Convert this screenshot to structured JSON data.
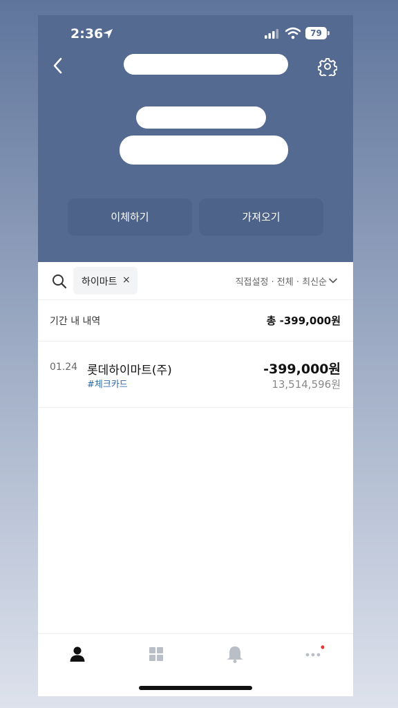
{
  "status_bar": {
    "time": "2:36",
    "battery": "79"
  },
  "account": {
    "actions": {
      "transfer": "이체하기",
      "fetch": "가져오기"
    }
  },
  "filter": {
    "chip_label": "하이마트",
    "chip_close": "×",
    "sort": "직접설정 · 전체 · 최신순"
  },
  "summary": {
    "label": "기간 내 내역",
    "total": "총 -399,000원"
  },
  "transactions": [
    {
      "date": "01.24",
      "merchant": "롯데하이마트(주)",
      "tag": "#체크카드",
      "amount": "-399,000원",
      "balance": "13,514,596원"
    }
  ],
  "colors": {
    "header_bg": "#546a90",
    "tag": "#2c6aa8",
    "notification_dot": "#e53935"
  },
  "icons": {
    "back": "chevron-left-icon",
    "settings": "gear-icon",
    "search": "search-icon",
    "tabs": [
      "person-icon",
      "grid-icon",
      "bell-icon",
      "more-icon"
    ]
  }
}
